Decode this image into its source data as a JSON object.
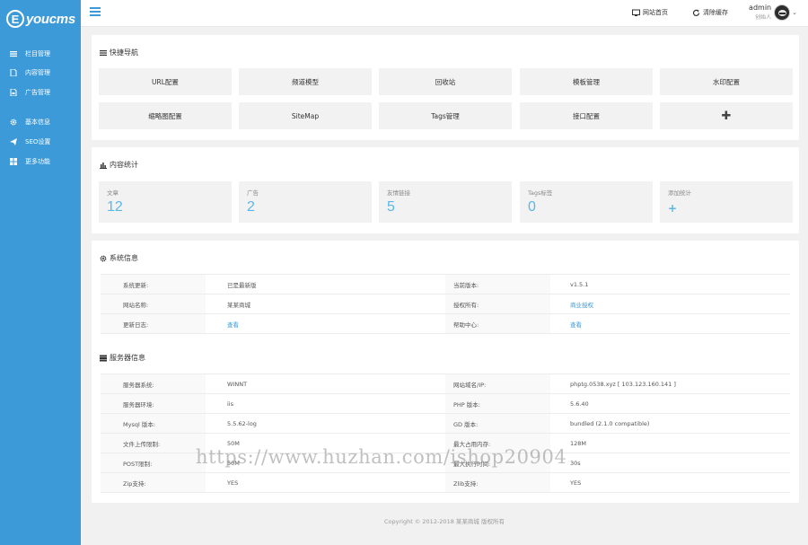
{
  "brand": {
    "logo_letter": "E",
    "logo_text": "youcms"
  },
  "sidebar": {
    "items": [
      {
        "label": "栏目管理",
        "icon": "list-icon"
      },
      {
        "label": "内容管理",
        "icon": "document-icon"
      },
      {
        "label": "广告管理",
        "icon": "image-document-icon"
      },
      {
        "label": "基本信息",
        "icon": "gear-icon"
      },
      {
        "label": "SEO设置",
        "icon": "send-icon"
      },
      {
        "label": "更多功能",
        "icon": "grid-icon"
      }
    ]
  },
  "topbar": {
    "home_label": "网站首页",
    "clear_cache_label": "清除缓存",
    "user_name": "admin",
    "user_role": "创始人"
  },
  "quick_nav": {
    "title": "快捷导航",
    "buttons": [
      "URL配置",
      "频道模型",
      "回收站",
      "模板管理",
      "水印配置",
      "缩略图配置",
      "SiteMap",
      "Tags管理",
      "接口配置",
      "✚"
    ]
  },
  "content_stats": {
    "title": "内容统计",
    "items": [
      {
        "label": "文章",
        "value": "12"
      },
      {
        "label": "广告",
        "value": "2"
      },
      {
        "label": "友情链接",
        "value": "5"
      },
      {
        "label": "Tags标签",
        "value": "0"
      },
      {
        "label": "添加统计",
        "value": "+"
      }
    ]
  },
  "system_info": {
    "title": "系统信息",
    "rows": [
      {
        "k1": "系统更新:",
        "v1": "已是最新版",
        "k2": "当前版本:",
        "v2": "v1.5.1"
      },
      {
        "k1": "网站名称:",
        "v1": "某某商城",
        "k2": "授权所有:",
        "v2": "商业授权"
      },
      {
        "k1": "更新日志:",
        "v1": "查看",
        "k2": "帮助中心:",
        "v2": "查看"
      }
    ]
  },
  "server_info": {
    "title": "服务器信息",
    "rows": [
      {
        "k1": "服务器系统:",
        "v1": "WINNT",
        "k2": "网站域名/IP:",
        "v2": "phptg.0538.xyz [ 103.123.160.141 ]"
      },
      {
        "k1": "服务器环境:",
        "v1": "iis",
        "k2": "PHP 版本:",
        "v2": "5.6.40"
      },
      {
        "k1": "Mysql 版本:",
        "v1": "5.5.62-log",
        "k2": "GD 版本:",
        "v2": "bundled (2.1.0 compatible)"
      },
      {
        "k1": "文件上传限制:",
        "v1": "50M",
        "k2": "最大占用内存:",
        "v2": "128M"
      },
      {
        "k1": "POST限制:",
        "v1": "50M",
        "k2": "最大执行时间:",
        "v2": "30s"
      },
      {
        "k1": "Zip支持:",
        "v1": "YES",
        "k2": "Zlib支持:",
        "v2": "YES"
      }
    ]
  },
  "footer": "Copyright © 2012-2018 某某商城 版权所有",
  "watermark": "https://www.huzhan.com/ishop20904",
  "colors": {
    "sidebar": "#3d9ad8",
    "stat_value": "#5ab7e8",
    "link": "#3d9ad8"
  }
}
